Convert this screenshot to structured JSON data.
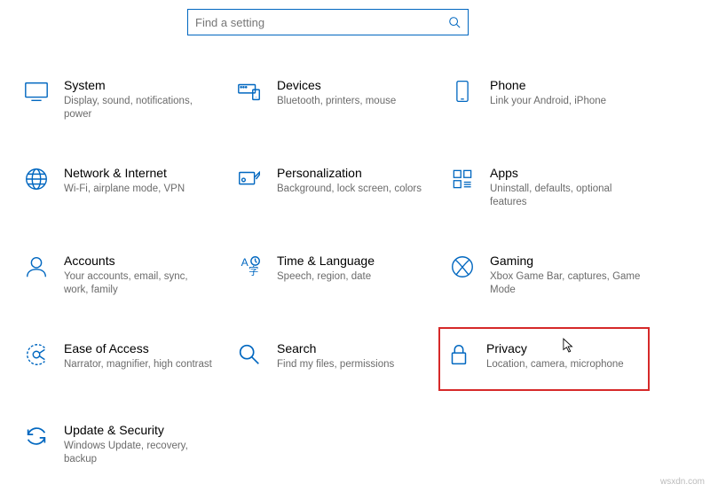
{
  "search": {
    "placeholder": "Find a setting"
  },
  "tiles": {
    "system": {
      "title": "System",
      "desc": "Display, sound, notifications, power"
    },
    "devices": {
      "title": "Devices",
      "desc": "Bluetooth, printers, mouse"
    },
    "phone": {
      "title": "Phone",
      "desc": "Link your Android, iPhone"
    },
    "network": {
      "title": "Network & Internet",
      "desc": "Wi-Fi, airplane mode, VPN"
    },
    "personalization": {
      "title": "Personalization",
      "desc": "Background, lock screen, colors"
    },
    "apps": {
      "title": "Apps",
      "desc": "Uninstall, defaults, optional features"
    },
    "accounts": {
      "title": "Accounts",
      "desc": "Your accounts, email, sync, work, family"
    },
    "time": {
      "title": "Time & Language",
      "desc": "Speech, region, date"
    },
    "gaming": {
      "title": "Gaming",
      "desc": "Xbox Game Bar, captures, Game Mode"
    },
    "ease": {
      "title": "Ease of Access",
      "desc": "Narrator, magnifier, high contrast"
    },
    "search_cat": {
      "title": "Search",
      "desc": "Find my files, permissions"
    },
    "privacy": {
      "title": "Privacy",
      "desc": "Location, camera, microphone"
    },
    "update": {
      "title": "Update & Security",
      "desc": "Windows Update, recovery, backup"
    }
  },
  "attribution": "wsxdn.com",
  "colors": {
    "accent": "#0067c0",
    "highlight": "#d62929"
  }
}
